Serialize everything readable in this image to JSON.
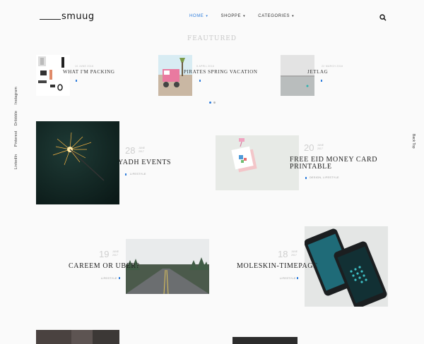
{
  "header": {
    "logo": "smuug",
    "nav": [
      {
        "label": "HOME",
        "active": true
      },
      {
        "label": "SHOPPE",
        "active": false
      },
      {
        "label": "CATEGORIES",
        "active": false
      }
    ],
    "search_icon": "search-icon"
  },
  "featured": {
    "title": "FEAUTURED",
    "items": [
      {
        "date": "10 JUNE 2016",
        "title": "WHAT I'M PACKING"
      },
      {
        "date": "8 APRIL 2016",
        "title": "PIRATES SPRING VACATION"
      },
      {
        "date": "22 MARCH 2016",
        "title": "JETLAG"
      }
    ],
    "dots": [
      true,
      false
    ]
  },
  "social": [
    "Instagram",
    "Dribbble",
    "Pinterest",
    "LinkedIn"
  ],
  "back_to_top": "Back Top",
  "posts": [
    {
      "day": "28",
      "month": "JUNE",
      "year": "2017",
      "title": "YADH EVENTS",
      "category": "LIFESTYLE"
    },
    {
      "day": "20",
      "month": "JUNE",
      "year": "2017",
      "title": "FREE EID MONEY CARD PRINTABLE",
      "title_lines": [
        "FREE EID MONEY CARD",
        "PRINTABLE"
      ],
      "category": "DESIGN, LIFESTYLE"
    },
    {
      "day": "19",
      "month": "JUNE",
      "year": "2017",
      "title": "CAREEM OR UBER?",
      "category": "LIFESTYLE"
    },
    {
      "day": "18",
      "month": "JUNE",
      "year": "2017",
      "title": "MOLESKIN-TIMEPAGE",
      "category": "LIFESTYLE"
    }
  ],
  "colors": {
    "accent": "#2f7ddc",
    "background": "#fafafa"
  }
}
